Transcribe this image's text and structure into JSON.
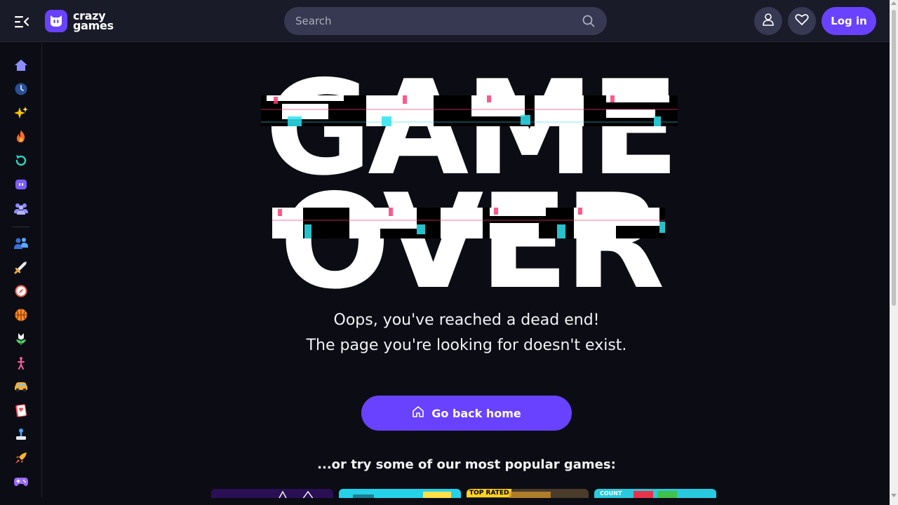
{
  "header": {
    "logo_line1": "crazy",
    "logo_line2": "games",
    "search_placeholder": "Search",
    "login_label": "Log in",
    "icons": [
      "menu-icon",
      "friends-icon",
      "heart-icon",
      "search-icon"
    ]
  },
  "sidebar": {
    "items": [
      {
        "name": "home",
        "icon": "home-icon",
        "color": "#8c8cff"
      },
      {
        "name": "recent",
        "icon": "clock-icon",
        "color": "#4a7fd6"
      },
      {
        "name": "new",
        "icon": "sparkles-icon",
        "color": "#f5c400"
      },
      {
        "name": "trending",
        "icon": "fire-icon",
        "color": "#ff6a2b"
      },
      {
        "name": "updated",
        "icon": "refresh-icon",
        "color": "#2fd3c1"
      },
      {
        "name": "originals",
        "icon": "originals-icon",
        "color": "#7b5cff"
      },
      {
        "name": "multiplayer",
        "icon": "group-icon",
        "color": "#8d8cff"
      },
      {
        "name": "two-player",
        "icon": "two-player-icon",
        "color": "#5aa8ff"
      },
      {
        "name": "action",
        "icon": "sword-icon",
        "color": "#f3c17a"
      },
      {
        "name": "adventure",
        "icon": "compass-icon",
        "color": "#ff5a4a"
      },
      {
        "name": "basketball",
        "icon": "basketball-icon",
        "color": "#ff8a2b"
      },
      {
        "name": "beauty",
        "icon": "flower-icon",
        "color": "#57d36b"
      },
      {
        "name": "bike",
        "icon": "bike-icon",
        "color": "#ff5aa0"
      },
      {
        "name": "car",
        "icon": "car-icon",
        "color": "#ffb02b"
      },
      {
        "name": "card",
        "icon": "card-icon",
        "color": "#ff4d5a"
      },
      {
        "name": "clicker",
        "icon": "clicker-icon",
        "color": "#4aa3ff"
      },
      {
        "name": "casual",
        "icon": "rocket-icon",
        "color": "#ffb02b"
      },
      {
        "name": "controller",
        "icon": "controller-icon",
        "color": "#9a6bff"
      }
    ]
  },
  "main": {
    "headline_line1": "GAME",
    "headline_line2": "OVER",
    "message_line1": "Oops, you've reached a dead end!",
    "message_line2": "The page you're looking for doesn't exist.",
    "home_button_label": "Go back home",
    "popular_title": "...or try some of our most popular games:",
    "thumbnails": [
      {
        "name": "game-thumb-1",
        "color": "#2a0f55",
        "badge": "",
        "label": ""
      },
      {
        "name": "game-thumb-2",
        "color": "#25d1e8",
        "badge": "",
        "label": ""
      },
      {
        "name": "game-thumb-3",
        "color": "#4a3b2a",
        "badge": "TOP RATED",
        "label": ""
      },
      {
        "name": "game-thumb-4",
        "color": "#29c9df",
        "badge": "",
        "label": "COUNT"
      }
    ]
  },
  "colors": {
    "accent": "#6842ff",
    "background": "#0c0d14",
    "topbar": "#1a1b28",
    "input": "#373952"
  }
}
